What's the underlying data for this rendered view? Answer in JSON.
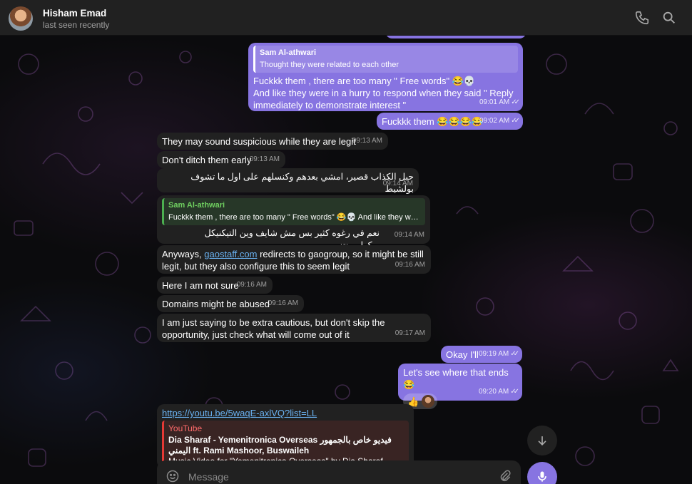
{
  "header": {
    "name": "Hisham Emad",
    "status": "last seen recently"
  },
  "messages": {
    "m1_quote_name": "Sam Al-athwari",
    "m1_quote_text": "Thought they were related to each other",
    "m1_line1": "Fuckkk them , there are too many \" Free words\"  😂💀",
    "m1_line2": "And like they were in a hurry to respond when they said \" Reply immediately to demonstrate interest \"",
    "m1_time": "09:01 AM",
    "m2_text": "Fuckkk them 😂😂😂😂",
    "m2_time": "09:02 AM",
    "m3_text": "They may sound suspicious while they are legit",
    "m3_time": "09:13 AM",
    "m4_text": "Don't ditch them early",
    "m4_time": "09:13 AM",
    "m5_text": "حبل الكذاب قصير، امشي بعدهم وكنسلهم على اول ما تشوف بولشيط",
    "m5_time": "09:14 AM",
    "m6_quote_name": "Sam Al-athwari",
    "m6_quote_text": "Fuckkk them , there are too many \" Free words\" 😂💀 And like they wer...",
    "m6_text": "نعم في رغوه كثير بس مش شايف وين التيكنيكل ريكوايرمنتز",
    "m6_time": "09:14 AM",
    "m7_pre": "Anyways, ",
    "m7_link": "gaostaff.com",
    "m7_post": " redirects to gaogroup, so it might be still legit, but they also configure this to seem legit",
    "m7_time": "09:16 AM",
    "m8_text": "Here I am not sure",
    "m8_time": "09:16 AM",
    "m9_text": "Domains might be abused",
    "m9_time": "09:16 AM",
    "m10_text": "I am just saying to be extra cautious, but don't skip the opportunity, just check what will come out of it",
    "m10_time": "09:17 AM",
    "m11_text": "Okay I'll",
    "m11_time": "09:19 AM",
    "m12_text": "Let's see where that ends 😂",
    "m12_reaction": "👍",
    "m12_time": "09:20 AM",
    "m13_link": "https://youtu.be/5waqE-axlVQ?list=LL",
    "m13_source": "YouTube",
    "m13_title": "Dia Sharaf - Yemenitronica Overseas فيديو خاص بالجمهور اليمني ft. Rami Mashoor, Buswaileh",
    "m13_desc": "Music Video for \"Yemenitronica Overseas\" by Dia Sharaf featuring"
  },
  "composer": {
    "placeholder": "Message"
  },
  "colors": {
    "outgoing": "#8774e1",
    "incoming": "#212121",
    "link": "#6ab2f2",
    "quote_green": "#4caf50",
    "youtube_red": "#e53935"
  },
  "icons": [
    "phone-icon",
    "search-icon",
    "emoji-icon",
    "attach-icon",
    "mic-icon",
    "arrow-down-icon"
  ]
}
